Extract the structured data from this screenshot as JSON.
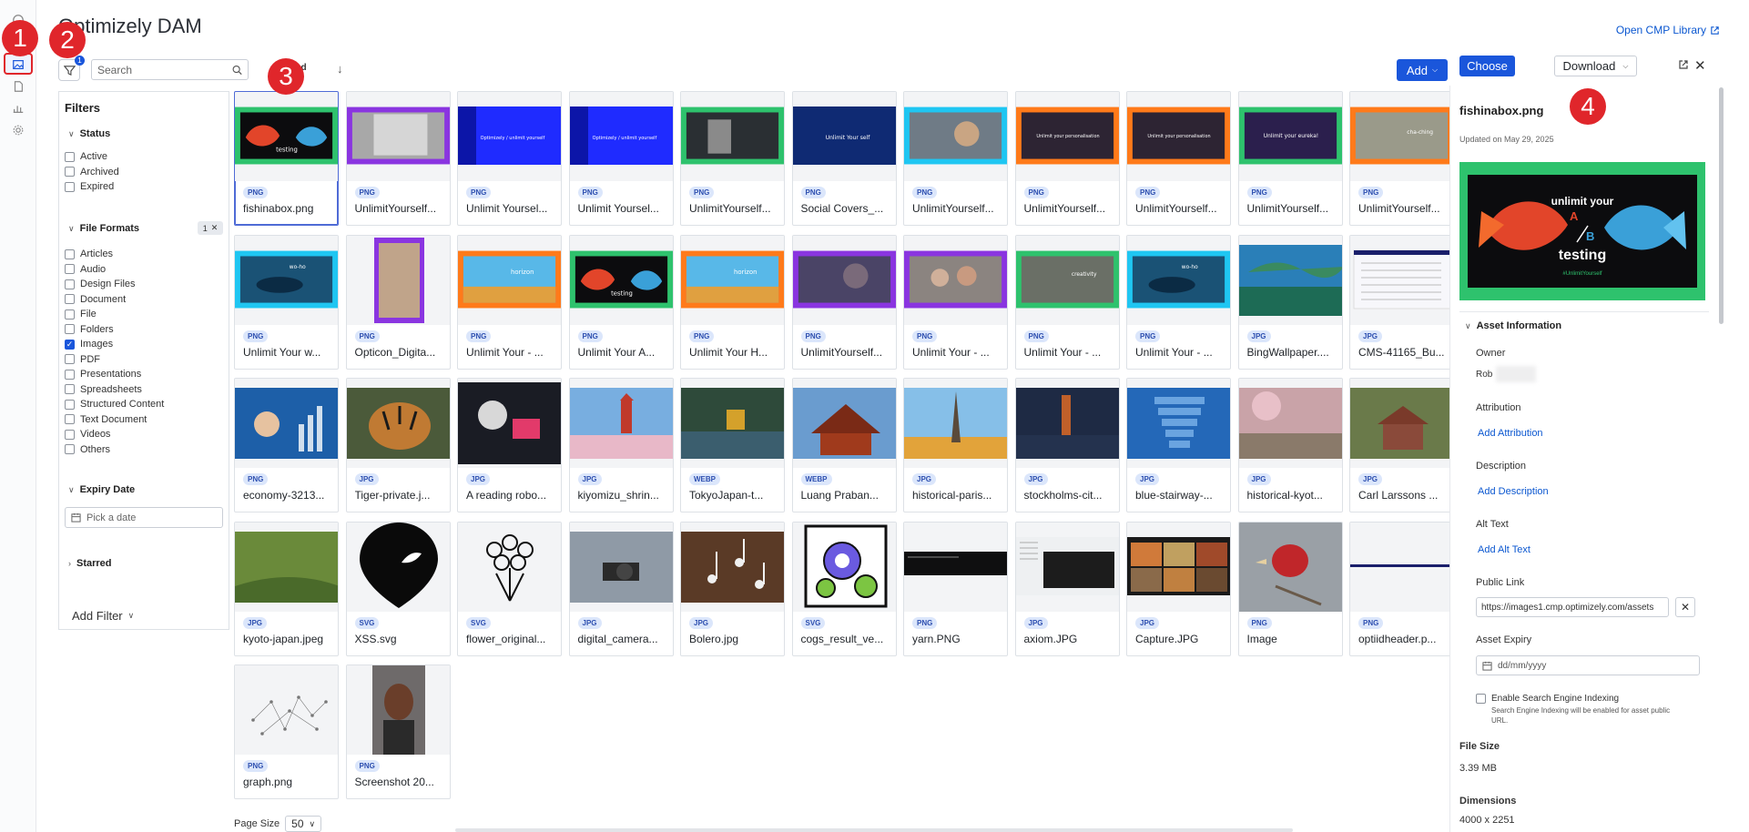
{
  "app": {
    "title": "Optimizely DAM",
    "open_cmp_label": "Open CMP Library"
  },
  "markers": [
    "1",
    "2",
    "3",
    "4"
  ],
  "toolbar": {
    "filter_count": "1",
    "search_placeholder": "Search",
    "sort_label": "dified",
    "sort_direction": "↓",
    "add_label": "Add",
    "choose_label": "Choose",
    "download_label": "Download"
  },
  "filters": {
    "title": "Filters",
    "status": {
      "title": "Status",
      "options": [
        {
          "label": "Active",
          "checked": false
        },
        {
          "label": "Archived",
          "checked": false
        },
        {
          "label": "Expired",
          "checked": false
        }
      ]
    },
    "formats": {
      "title": "File Formats",
      "chip_count": "1",
      "options": [
        {
          "label": "Articles",
          "checked": false
        },
        {
          "label": "Audio",
          "checked": false
        },
        {
          "label": "Design Files",
          "checked": false
        },
        {
          "label": "Document",
          "checked": false
        },
        {
          "label": "File",
          "checked": false
        },
        {
          "label": "Folders",
          "checked": false
        },
        {
          "label": "Images",
          "checked": true
        },
        {
          "label": "PDF",
          "checked": false
        },
        {
          "label": "Presentations",
          "checked": false
        },
        {
          "label": "Spreadsheets",
          "checked": false
        },
        {
          "label": "Structured Content",
          "checked": false
        },
        {
          "label": "Text Document",
          "checked": false
        },
        {
          "label": "Videos",
          "checked": false
        },
        {
          "label": "Others",
          "checked": false
        }
      ]
    },
    "expiry": {
      "title": "Expiry Date",
      "placeholder": "Pick a date"
    },
    "starred": {
      "title": "Starred"
    },
    "add_filter_label": "Add Filter"
  },
  "assets": [
    {
      "type": "PNG",
      "name": "fishinabox.png",
      "thumb": "green-fish",
      "selected": true
    },
    {
      "type": "PNG",
      "name": "UnlimitYourself...",
      "thumb": "purple-text"
    },
    {
      "type": "PNG",
      "name": "Unlimit Yoursel...",
      "thumb": "blue-logo"
    },
    {
      "type": "PNG",
      "name": "Unlimit Yoursel...",
      "thumb": "blue-logo"
    },
    {
      "type": "PNG",
      "name": "UnlimitYourself...",
      "thumb": "green-gray"
    },
    {
      "type": "PNG",
      "name": "Social Covers_...",
      "thumb": "navy-text"
    },
    {
      "type": "PNG",
      "name": "UnlimitYourself...",
      "thumb": "cyan-photo"
    },
    {
      "type": "PNG",
      "name": "UnlimitYourself...",
      "thumb": "orange-dark"
    },
    {
      "type": "PNG",
      "name": "UnlimitYourself...",
      "thumb": "orange-dark"
    },
    {
      "type": "PNG",
      "name": "UnlimitYourself...",
      "thumb": "green-eureka"
    },
    {
      "type": "PNG",
      "name": "UnlimitYourself...",
      "thumb": "orange-money"
    },
    {
      "type": "PNG",
      "name": "Unlimit Your w...",
      "thumb": "cyan-whale"
    },
    {
      "type": "PNG",
      "name": "Opticon_Digita...",
      "thumb": "purple-portrait"
    },
    {
      "type": "PNG",
      "name": "Unlimit Your - ...",
      "thumb": "orange-horizon"
    },
    {
      "type": "PNG",
      "name": "Unlimit Your A...",
      "thumb": "green-fish"
    },
    {
      "type": "PNG",
      "name": "Unlimit Your H...",
      "thumb": "orange-horizon"
    },
    {
      "type": "PNG",
      "name": "UnlimitYourself...",
      "thumb": "purple-dark"
    },
    {
      "type": "PNG",
      "name": "Unlimit Your - ...",
      "thumb": "purple-people"
    },
    {
      "type": "PNG",
      "name": "Unlimit Your - ...",
      "thumb": "green-creativity"
    },
    {
      "type": "PNG",
      "name": "Unlimit Your - ...",
      "thumb": "cyan-whale"
    },
    {
      "type": "JPG",
      "name": "BingWallpaper....",
      "thumb": "ocean"
    },
    {
      "type": "JPG",
      "name": "CMS-41165_Bu...",
      "thumb": "screen-doc"
    },
    {
      "type": "PNG",
      "name": "economy-3213...",
      "thumb": "economy"
    },
    {
      "type": "JPG",
      "name": "Tiger-private.j...",
      "thumb": "tiger"
    },
    {
      "type": "JPG",
      "name": "A reading robo...",
      "thumb": "robot"
    },
    {
      "type": "JPG",
      "name": "kiyomizu_shrin...",
      "thumb": "shrine"
    },
    {
      "type": "WEBP",
      "name": "TokyoJapan-t...",
      "thumb": "temple-lake"
    },
    {
      "type": "WEBP",
      "name": "Luang Praban...",
      "thumb": "temple"
    },
    {
      "type": "JPG",
      "name": "historical-paris...",
      "thumb": "paris"
    },
    {
      "type": "JPG",
      "name": "stockholms-cit...",
      "thumb": "stockholm"
    },
    {
      "type": "JPG",
      "name": "blue-stairway-...",
      "thumb": "blue-stairs"
    },
    {
      "type": "JPG",
      "name": "historical-kyot...",
      "thumb": "kyoto-street"
    },
    {
      "type": "JPG",
      "name": "Carl Larssons ...",
      "thumb": "house"
    },
    {
      "type": "JPG",
      "name": "kyoto-japan.jpeg",
      "thumb": "kyoto-garden"
    },
    {
      "type": "SVG",
      "name": "XSS.svg",
      "thumb": "xss-logo"
    },
    {
      "type": "SVG",
      "name": "flower_original...",
      "thumb": "flower"
    },
    {
      "type": "JPG",
      "name": "digital_camera...",
      "thumb": "camera"
    },
    {
      "type": "JPG",
      "name": "Bolero.jpg",
      "thumb": "notes"
    },
    {
      "type": "SVG",
      "name": "cogs_result_ve...",
      "thumb": "cogs"
    },
    {
      "type": "PNG",
      "name": "yarn.PNG",
      "thumb": "terminal"
    },
    {
      "type": "JPG",
      "name": "axiom.JPG",
      "thumb": "axiom"
    },
    {
      "type": "JPG",
      "name": "Capture.JPG",
      "thumb": "capture"
    },
    {
      "type": "PNG",
      "name": "Image",
      "thumb": "bird"
    },
    {
      "type": "PNG",
      "name": "optiidheader.p...",
      "thumb": "header-line"
    },
    {
      "type": "PNG",
      "name": "graph.png",
      "thumb": "graph"
    },
    {
      "type": "PNG",
      "name": "Screenshot 20...",
      "thumb": "portrait"
    }
  ],
  "pagination": {
    "label": "Page Size",
    "value": "50"
  },
  "details": {
    "name": "fishinabox.png",
    "updated": "Updated on May 29, 2025",
    "preview_line1": "unlimit your",
    "preview_a": "A",
    "preview_b": "B",
    "preview_line2": "testing",
    "preview_tag": "#UnlimitYourself",
    "section_title": "Asset Information",
    "owner_label": "Owner",
    "owner_value": "Rob",
    "attribution_label": "Attribution",
    "attribution_link": "Add Attribution",
    "description_label": "Description",
    "description_link": "Add Description",
    "alt_label": "Alt Text",
    "alt_link": "Add Alt Text",
    "public_link_label": "Public Link",
    "public_link_value": "https://images1.cmp.optimizely.com/assets",
    "expiry_label": "Asset Expiry",
    "expiry_placeholder": "dd/mm/yyyy",
    "seo_label": "Enable Search Engine Indexing",
    "seo_hint": "Search Engine Indexing will be enabled for asset public URL.",
    "file_size_label": "File Size",
    "file_size_value": "3.39 MB",
    "dimensions_label": "Dimensions",
    "dimensions_value": "4000 x 2251"
  },
  "colors": {
    "accent": "#1a56db",
    "marker": "#e0262b",
    "link": "#0b57d0"
  }
}
